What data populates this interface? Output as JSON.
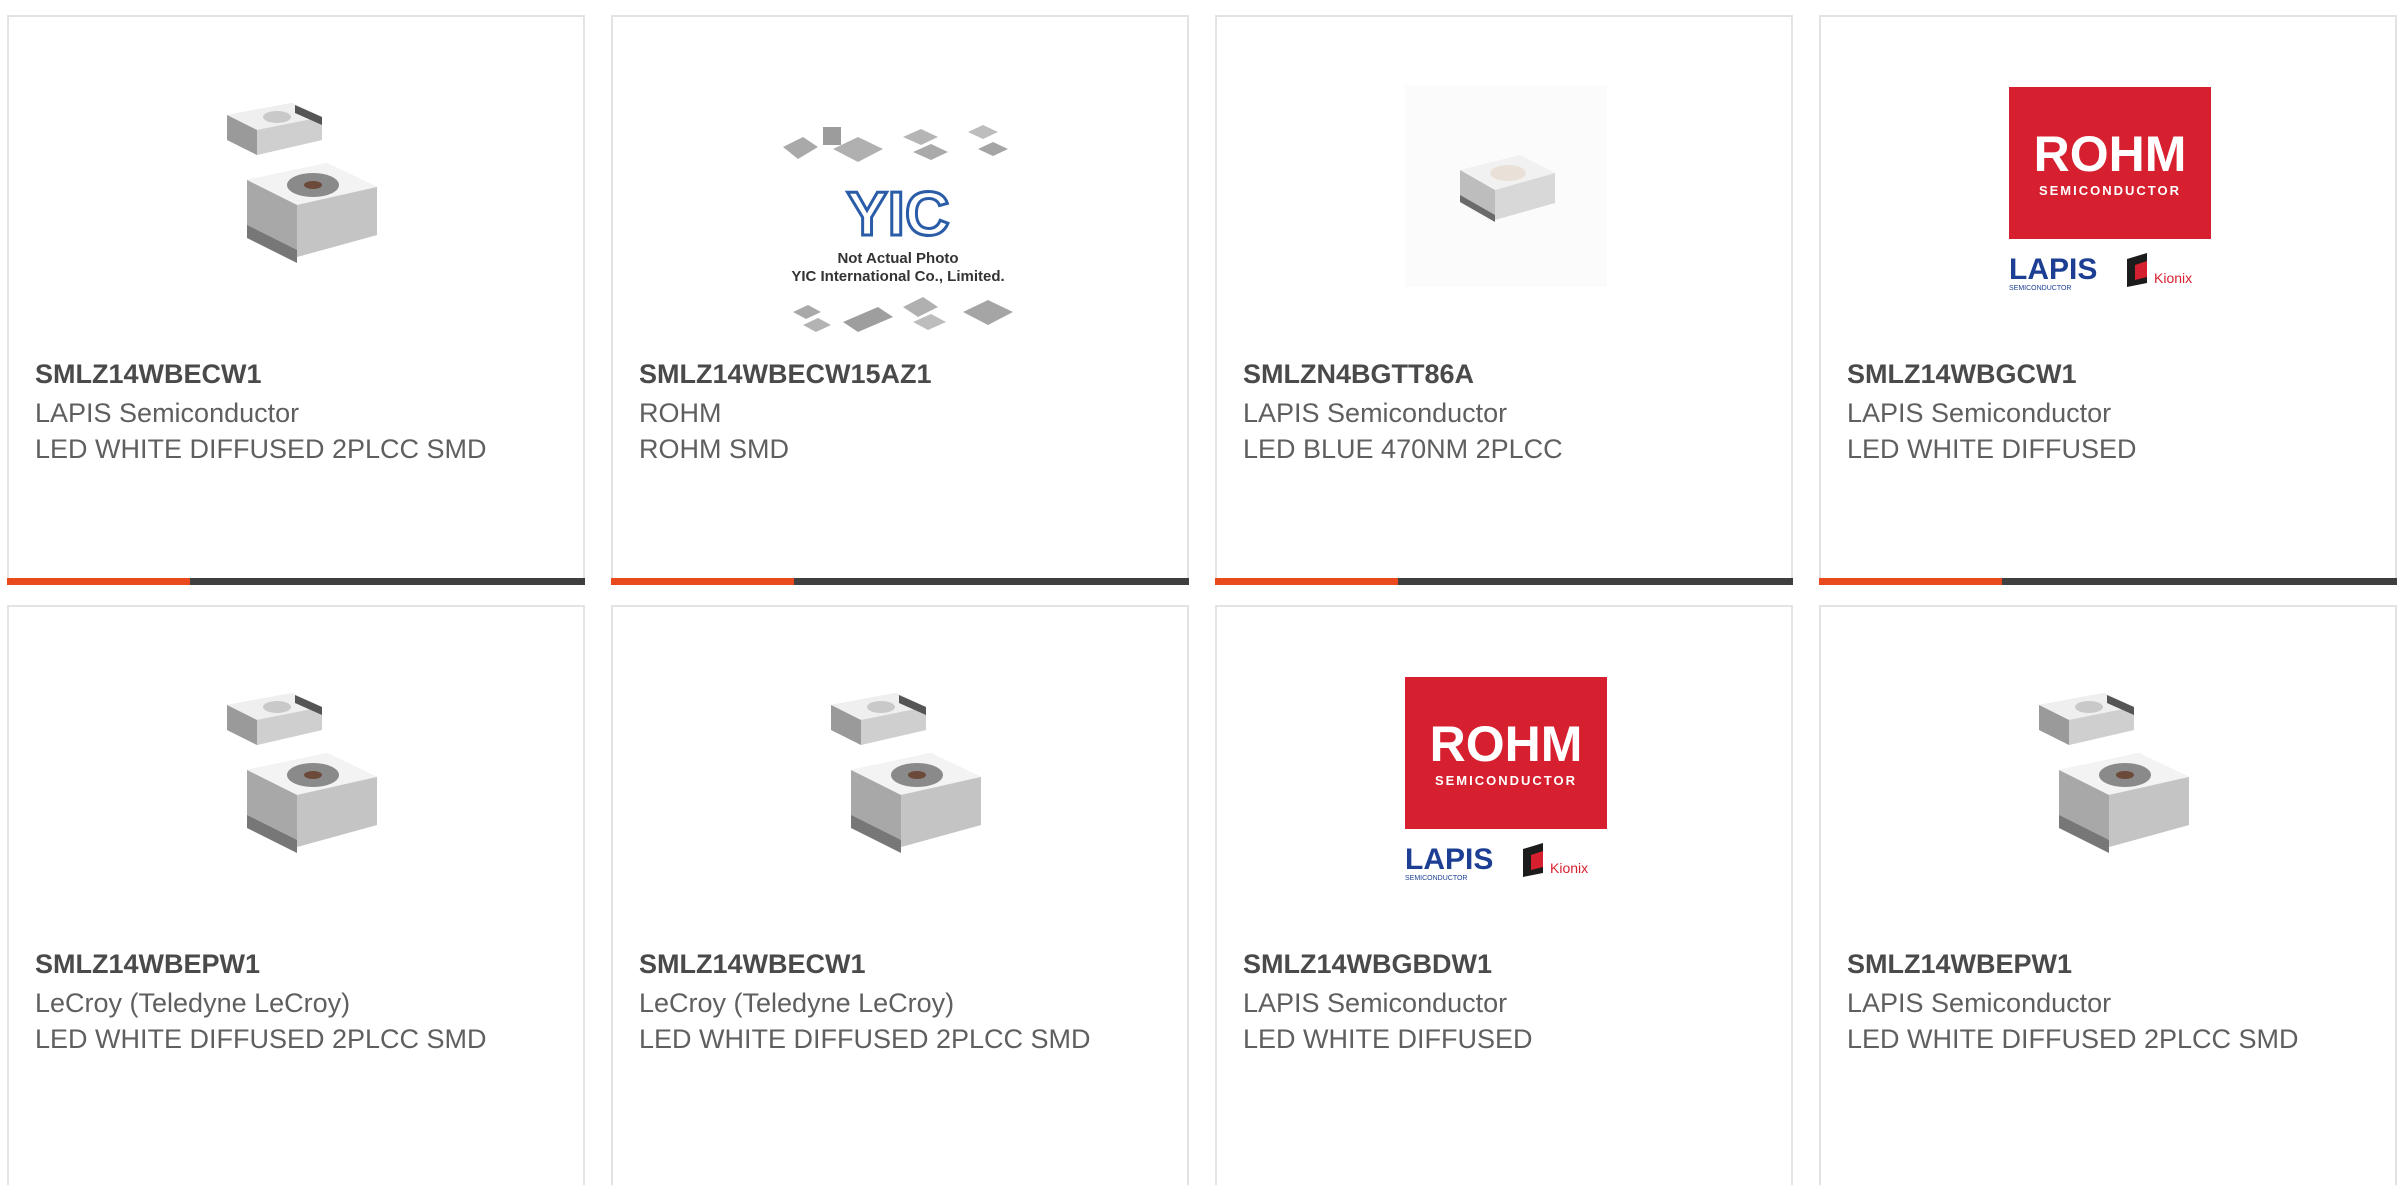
{
  "accent_color": "#e8491d",
  "products": [
    {
      "part": "SMLZ14WBECW1",
      "manufacturer": "LAPIS Semiconductor",
      "description": "LED WHITE DIFFUSED 2PLCC SMD",
      "image": "led-package-photo"
    },
    {
      "part": "SMLZ14WBECW15AZ1",
      "manufacturer": "ROHM",
      "description": "ROHM SMD",
      "image": "yic-placeholder-photo",
      "placeholder_line1": "Not Actual Photo",
      "placeholder_line2": "YIC International Co., Limited.",
      "placeholder_logo": "YIC"
    },
    {
      "part": "SMLZN4BGTT86A",
      "manufacturer": "LAPIS Semiconductor",
      "description": "LED BLUE 470NM 2PLCC",
      "image": "small-led-photo"
    },
    {
      "part": "SMLZ14WBGCW1",
      "manufacturer": "LAPIS Semiconductor",
      "description": "LED WHITE DIFFUSED",
      "image": "rohm-logo",
      "logo_main": "ROHM",
      "logo_sub": "SEMICONDUCTOR",
      "logo_lapis": "LAPIS",
      "logo_lapis_sub": "SEMICONDUCTOR",
      "logo_kionix": "Kionix"
    },
    {
      "part": "SMLZ14WBEPW1",
      "manufacturer": "LeCroy (Teledyne LeCroy)",
      "description": "LED WHITE DIFFUSED 2PLCC SMD",
      "image": "led-package-photo"
    },
    {
      "part": "SMLZ14WBECW1",
      "manufacturer": "LeCroy (Teledyne LeCroy)",
      "description": "LED WHITE DIFFUSED 2PLCC SMD",
      "image": "led-package-photo"
    },
    {
      "part": "SMLZ14WBGBDW1",
      "manufacturer": "LAPIS Semiconductor",
      "description": "LED WHITE DIFFUSED",
      "image": "rohm-logo",
      "logo_main": "ROHM",
      "logo_sub": "SEMICONDUCTOR",
      "logo_lapis": "LAPIS",
      "logo_lapis_sub": "SEMICONDUCTOR",
      "logo_kionix": "Kionix"
    },
    {
      "part": "SMLZ14WBEPW1",
      "manufacturer": "LAPIS Semiconductor",
      "description": "LED WHITE DIFFUSED 2PLCC SMD",
      "image": "led-package-photo"
    }
  ]
}
